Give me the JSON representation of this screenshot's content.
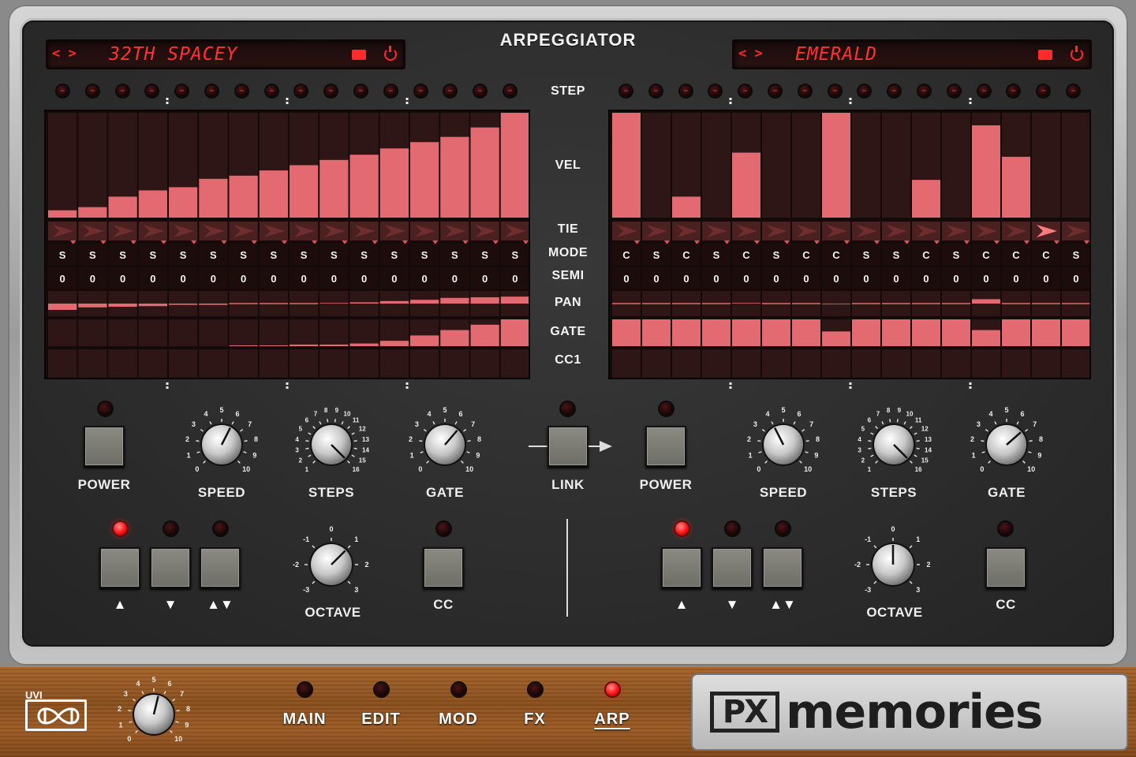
{
  "title": "ARPEGGIATOR",
  "row_labels": [
    "STEP",
    "VEL",
    "TIE",
    "MODE",
    "SEMI",
    "PAN",
    "GATE",
    "CC1"
  ],
  "left": {
    "preset_arrows": "< >",
    "preset_name": "32TH SPACEY",
    "step_led_active": -1,
    "vel": [
      0.07,
      0.1,
      0.2,
      0.26,
      0.29,
      0.37,
      0.4,
      0.45,
      0.5,
      0.55,
      0.6,
      0.66,
      0.72,
      0.77,
      0.86,
      1.0
    ],
    "tie": [
      0,
      0,
      0,
      0,
      0,
      0,
      0,
      0,
      0,
      0,
      0,
      0,
      0,
      0,
      0,
      0
    ],
    "mode": [
      "S",
      "S",
      "S",
      "S",
      "S",
      "S",
      "S",
      "S",
      "S",
      "S",
      "S",
      "S",
      "S",
      "S",
      "S",
      "S"
    ],
    "semi": [
      "0",
      "0",
      "0",
      "0",
      "0",
      "0",
      "0",
      "0",
      "0",
      "0",
      "0",
      "0",
      "0",
      "0",
      "0",
      "0"
    ],
    "pan": [
      -0.5,
      -0.3,
      -0.25,
      -0.2,
      -0.1,
      -0.1,
      0,
      0,
      0,
      0.05,
      0.1,
      0.2,
      0.3,
      0.45,
      0.5,
      0.55
    ],
    "gate": [
      0,
      0,
      0,
      0,
      0,
      0,
      0.03,
      0.03,
      0.06,
      0.06,
      0.1,
      0.2,
      0.4,
      0.6,
      0.8,
      1.0
    ],
    "cc1": [
      0,
      0,
      0,
      0,
      0,
      0,
      0,
      0,
      0,
      0,
      0,
      0,
      0,
      0,
      0,
      0
    ],
    "power_label": "POWER",
    "power_on": false,
    "speed_label": "SPEED",
    "steps_label": "STEPS",
    "gate_label": "GATE",
    "speed_value": 6,
    "steps_value": 16,
    "gate_value": 6.5,
    "octave_label": "OCTAVE",
    "octave_value": 1,
    "cc_label": "CC",
    "dir_buttons": [
      "▲",
      "▼",
      "▲▼"
    ],
    "dir_active": 0,
    "speed_ticks": [
      "0",
      "1",
      "2",
      "3",
      "4",
      "5",
      "6",
      "7",
      "8",
      "9",
      "10"
    ],
    "steps_ticks": [
      "1",
      "2",
      "3",
      "4",
      "5",
      "6",
      "7",
      "8",
      "9",
      "10",
      "11",
      "12",
      "13",
      "14",
      "15",
      "16"
    ],
    "gate_ticks": [
      "0",
      "1",
      "2",
      "3",
      "4",
      "5",
      "6",
      "7",
      "8",
      "9",
      "10"
    ],
    "octave_ticks": [
      "-3",
      "-2",
      "-1",
      "0",
      "1",
      "2",
      "3"
    ]
  },
  "right": {
    "preset_arrows": "< >",
    "preset_name": "EMERALD",
    "step_led_active": -1,
    "vel": [
      1.0,
      0,
      0.2,
      0,
      0.62,
      0,
      0,
      1.0,
      0,
      0,
      0.36,
      0,
      0.88,
      0.58,
      0,
      0
    ],
    "tie": [
      0,
      0,
      0,
      0,
      0,
      0,
      0,
      0,
      0,
      0,
      0,
      0,
      0,
      0,
      1,
      0
    ],
    "mode": [
      "C",
      "S",
      "C",
      "S",
      "C",
      "S",
      "C",
      "C",
      "S",
      "S",
      "C",
      "S",
      "C",
      "C",
      "C",
      "S"
    ],
    "semi": [
      "0",
      "0",
      "0",
      "0",
      "0",
      "0",
      "0",
      "0",
      "0",
      "0",
      "0",
      "0",
      "0",
      "0",
      "0",
      "0"
    ],
    "pan": [
      0,
      0,
      0,
      0,
      0.05,
      0,
      0,
      -0.05,
      0,
      0,
      0,
      0,
      0.35,
      0,
      0,
      0
    ],
    "gate": [
      1,
      1,
      1,
      1,
      1,
      1,
      1,
      0.55,
      1,
      1,
      1,
      1,
      0.6,
      1,
      1,
      1
    ],
    "cc1": [
      0,
      0,
      0,
      0,
      0,
      0,
      0,
      0,
      0,
      0,
      0,
      0,
      0,
      0,
      0,
      0
    ],
    "power_label": "POWER",
    "power_on": false,
    "speed_label": "SPEED",
    "steps_label": "STEPS",
    "gate_label": "GATE",
    "speed_value": 4,
    "steps_value": 16,
    "gate_value": 6.8,
    "octave_label": "OCTAVE",
    "octave_value": 0,
    "cc_label": "CC",
    "dir_buttons": [
      "▲",
      "▼",
      "▲▼"
    ],
    "dir_active": 0,
    "speed_ticks": [
      "0",
      "1",
      "2",
      "3",
      "4",
      "5",
      "6",
      "7",
      "8",
      "9",
      "10"
    ],
    "steps_ticks": [
      "1",
      "2",
      "3",
      "4",
      "5",
      "6",
      "7",
      "8",
      "9",
      "10",
      "11",
      "12",
      "13",
      "14",
      "15",
      "16"
    ],
    "gate_ticks": [
      "0",
      "1",
      "2",
      "3",
      "4",
      "5",
      "6",
      "7",
      "8",
      "9",
      "10"
    ],
    "octave_ticks": [
      "-3",
      "-2",
      "-1",
      "0",
      "1",
      "2",
      "3"
    ]
  },
  "link_label": "LINK",
  "bottom": {
    "brand": "UVI",
    "volume_ticks": [
      "0",
      "1",
      "2",
      "3",
      "4",
      "5",
      "6",
      "7",
      "8",
      "9",
      "10"
    ],
    "volume_value": 5.5,
    "nav": [
      "MAIN",
      "EDIT",
      "MOD",
      "FX",
      "ARP"
    ],
    "nav_active": 4,
    "logo_px": "PX",
    "logo_text": "memories"
  },
  "colors": {
    "bar": "#e26a70",
    "cell": "#2e1616",
    "lcd_text": "#ff3232",
    "led_on": "#ff1010"
  }
}
